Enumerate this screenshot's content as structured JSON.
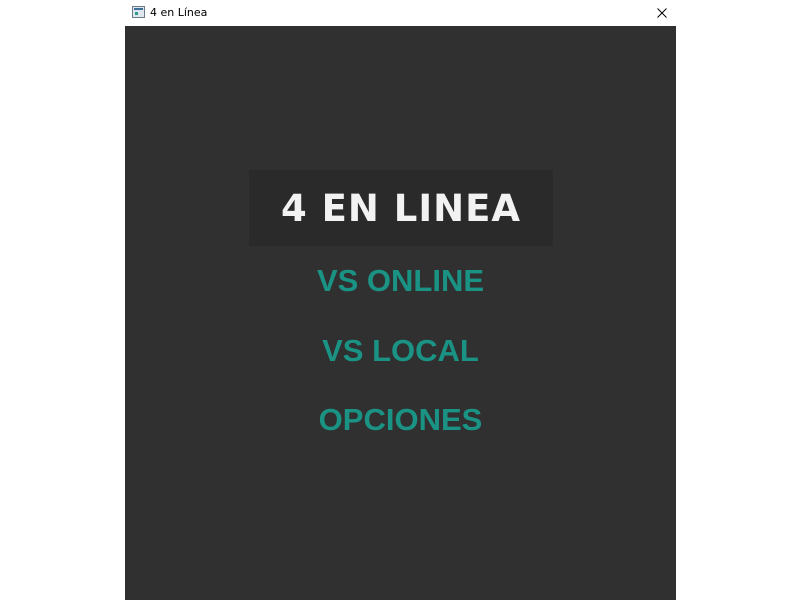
{
  "window": {
    "title": "4 en Línea",
    "app_icon": "window-app-icon",
    "close_icon": "close-icon"
  },
  "menu": {
    "title": "4 EN LINEA",
    "items": [
      {
        "label": "VS ONLINE"
      },
      {
        "label": "VS LOCAL"
      },
      {
        "label": "OPCIONES"
      }
    ]
  },
  "colors": {
    "background": "#303030",
    "title_panel": "#2a2a2a",
    "title_text": "#f2f2f2",
    "menu_text": "#1a9385"
  }
}
